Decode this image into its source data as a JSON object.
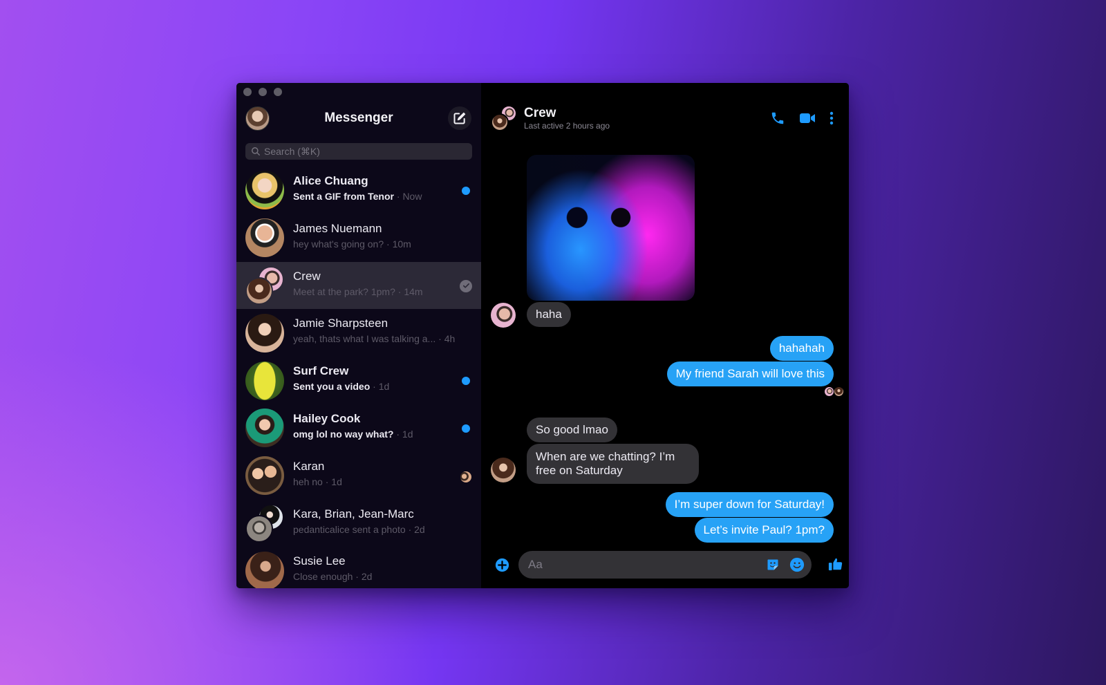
{
  "window": {
    "traffic_lights": [
      "close",
      "minimize",
      "zoom"
    ]
  },
  "sidebar": {
    "title": "Messenger",
    "profile_avatar_icon": "user-avatar",
    "compose_icon": "compose-icon",
    "search": {
      "placeholder": "Search (⌘K)",
      "value": "",
      "icon": "search-icon"
    },
    "conversations": [
      {
        "name": "Alice Chuang",
        "preview": "Sent a GIF from Tenor",
        "time": "Now",
        "unread": true,
        "status": "unread-dot"
      },
      {
        "name": "James Nuemann",
        "preview": "hey what's going on?",
        "time": "10m",
        "unread": false,
        "status": "none"
      },
      {
        "name": "Crew",
        "preview": "Meet at the park? 1pm?",
        "time": "14m",
        "unread": false,
        "status": "sent-check",
        "active": true,
        "group": true
      },
      {
        "name": "Jamie Sharpsteen",
        "preview": "yeah, thats what I was talking a...",
        "time": "4h",
        "unread": false,
        "status": "none"
      },
      {
        "name": "Surf Crew",
        "preview": "Sent you a video",
        "time": "1d",
        "unread": true,
        "status": "unread-dot"
      },
      {
        "name": "Hailey Cook",
        "preview": "omg lol no way what?",
        "time": "1d",
        "unread": true,
        "status": "unread-dot"
      },
      {
        "name": "Karan",
        "preview": "heh no",
        "time": "1d",
        "unread": false,
        "status": "seen-avatar"
      },
      {
        "name": "Kara, Brian, Jean-Marc",
        "preview": "pedanticalice sent a photo",
        "time": "2d",
        "unread": false,
        "status": "none",
        "group": true
      },
      {
        "name": "Susie Lee",
        "preview": "Close enough",
        "time": "2d",
        "unread": false,
        "status": "none"
      }
    ],
    "separator": " · "
  },
  "chat": {
    "title": "Crew",
    "subtitle": "Last active 2 hours ago",
    "header_icons": [
      "phone-icon",
      "video-camera-icon",
      "more-options-icon"
    ],
    "messages": [
      {
        "type": "image",
        "direction": "incoming",
        "description": "Neon blue and pink cat wearing round sunglasses"
      },
      {
        "type": "text",
        "direction": "incoming",
        "text": "haha"
      },
      {
        "type": "text",
        "direction": "outgoing",
        "text": "hahahah"
      },
      {
        "type": "text",
        "direction": "outgoing",
        "text": "My friend Sarah will love this",
        "read_receipts": 2
      },
      {
        "type": "text",
        "direction": "incoming",
        "text": "So good lmao"
      },
      {
        "type": "text",
        "direction": "incoming",
        "text": "When are we chatting? I’m free on Saturday"
      },
      {
        "type": "text",
        "direction": "outgoing",
        "text": "I’m super down for Saturday!"
      },
      {
        "type": "text",
        "direction": "outgoing",
        "text": "Let’s invite Paul? 1pm?"
      }
    ],
    "composer": {
      "placeholder": "Aa",
      "value": "",
      "icons": [
        "add-icon",
        "sticker-icon",
        "emoji-icon",
        "thumbs-up-icon"
      ]
    }
  },
  "colors": {
    "accent_blue": "#27a2f6",
    "unread_dot": "#1e9bff",
    "sidebar_bg": "#0c0819",
    "chat_bg": "#000000",
    "incoming_bubble": "#333236",
    "active_row": "#2c2937"
  }
}
